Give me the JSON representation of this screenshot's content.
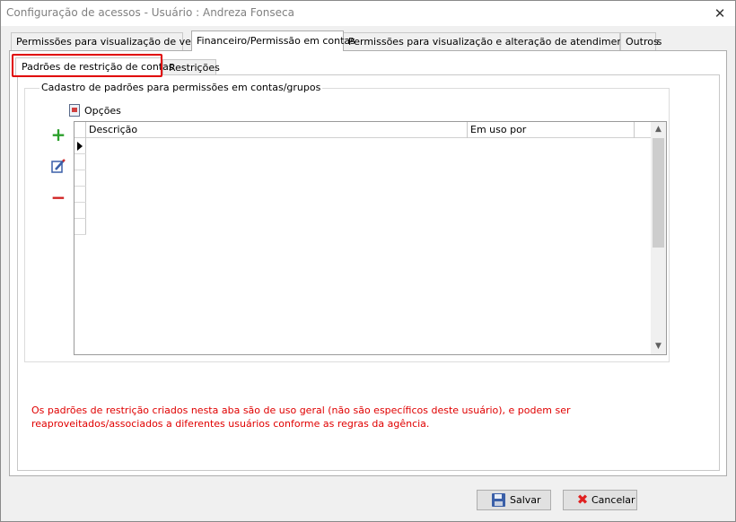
{
  "window": {
    "title": "Configuração de acessos - Usuário : Andreza Fonseca",
    "close_glyph": "✕"
  },
  "tabs": [
    {
      "label": "Permissões para visualização de vendas"
    },
    {
      "label": "Financeiro/Permissão em contas",
      "active": true
    },
    {
      "label": "Permissões para visualização e alteração de atendimentos/files"
    },
    {
      "label": "Outros"
    }
  ],
  "subtabs": [
    {
      "label": "Padrões de restrição de contas",
      "active": true
    },
    {
      "label": "Restrições"
    }
  ],
  "group": {
    "title": "Cadastro de padrões para permissões em contas/grupos",
    "options_label": "Opções",
    "side_buttons": [
      "plus-icon",
      "edit-icon",
      "minus-icon"
    ]
  },
  "grid": {
    "columns": [
      "Descrição",
      "Em uso por"
    ],
    "rows": []
  },
  "note": "Os padrões de restrição criados nesta aba são de uso geral (não são específicos deste usuário), e podem ser reaproveitados/associados a diferentes usuários conforme as regras da agência.",
  "colors": {
    "highlight": "#e00000",
    "note_text": "#e00000"
  },
  "footer": {
    "save_label": "Salvar",
    "cancel_label": "Cancelar"
  }
}
